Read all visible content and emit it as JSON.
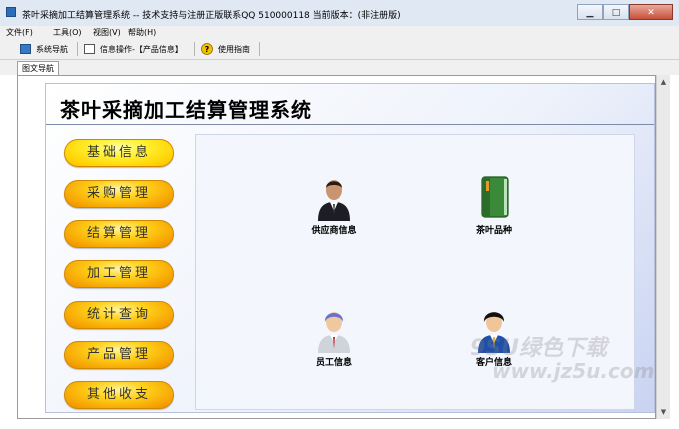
{
  "window": {
    "title": "茶叶采摘加工结算管理系统 -- 技术支持与注册正版联系QQ 510000118    当前版本：(非注册版)",
    "buttons": {
      "minimize": "▁",
      "maximize": "□",
      "close": "✕"
    }
  },
  "menu": [
    "文件(F)",
    "工具(O)",
    "视图(V)",
    "帮助(H)"
  ],
  "toolbar": {
    "nav_label": "系统导航",
    "info_label": "信息操作-【产品信息】",
    "help_label": "使用指南"
  },
  "tab": {
    "label": "图文导航"
  },
  "system_title": "茶叶采摘加工结算管理系统",
  "nav_buttons": [
    "基础信息",
    "采购管理",
    "结算管理",
    "加工管理",
    "统计查询",
    "产品管理",
    "其他收支"
  ],
  "items": {
    "supplier": "供应商信息",
    "tea": "茶叶品种",
    "staff": "员工信息",
    "customer": "客户信息"
  },
  "watermark": {
    "line1": "9SU绿色下载",
    "line2": "www.jz5u.com"
  },
  "colors": {
    "nav_button": "#ffc21a",
    "panel_gradient_end": "#c9d3f2",
    "title_rule": "#7d8aa8"
  }
}
